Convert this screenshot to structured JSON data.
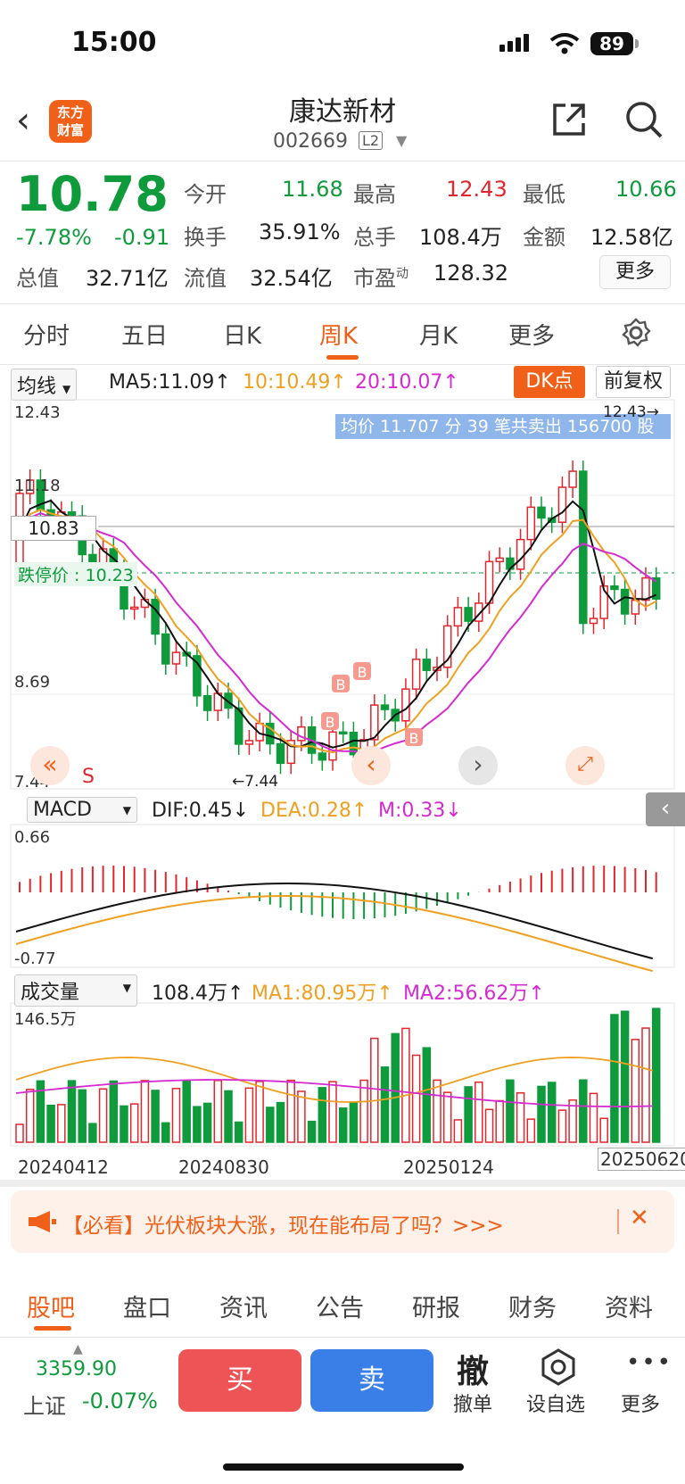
{
  "status": {
    "time": "15:00",
    "battery": "89"
  },
  "header": {
    "logo": [
      "东方",
      "财富"
    ],
    "stock_name": "康达新材",
    "stock_code": "002669",
    "level": "L2"
  },
  "quote": {
    "price": "10.78",
    "change_pct": "-7.78%",
    "change": "-0.91",
    "rows": [
      [
        {
          "label": "今开",
          "value": "11.68",
          "color": "green"
        },
        {
          "label": "最高",
          "value": "12.43",
          "color": "red"
        },
        {
          "label": "最低",
          "value": "10.66",
          "color": "green"
        }
      ],
      [
        {
          "label": "换手",
          "value": "35.91%",
          "color": "black"
        },
        {
          "label": "总手",
          "value": "108.4万",
          "color": "black"
        },
        {
          "label": "金额",
          "value": "12.58亿",
          "color": "black"
        }
      ],
      [
        {
          "label": "总值",
          "value": "32.71亿"
        },
        {
          "label": "流值",
          "value": "32.54亿"
        },
        {
          "label": "市盈",
          "sup": "动",
          "value": "128.32"
        }
      ]
    ],
    "more": "更多"
  },
  "tabs": {
    "items": [
      "分时",
      "五日",
      "日K",
      "周K",
      "月K",
      "更多"
    ],
    "active": 3
  },
  "ma_row": {
    "selector": "均线",
    "ma5": "MA5:11.09↑",
    "ma10": "10:10.49↑",
    "ma20": "20:10.07↑",
    "dk": "DK点",
    "fq": "前复权"
  },
  "kline": {
    "y_top": "12.43",
    "y_2": "11.18",
    "y_3": "8.69",
    "y_bottom": "7.44",
    "current_line": "10.83",
    "limit_label": "跌停价 : 10.23",
    "tooltip": "均价 11.707 分 39 笔共卖出 156700 股",
    "high_mark": "12.43→",
    "low_mark": "←7.44",
    "s_mark": "S"
  },
  "macd_row": {
    "selector": "MACD",
    "dif": "DIF:0.45↓",
    "dea": "DEA:0.28↑",
    "m": "M:0.33↓",
    "y_top": "0.66",
    "y_bottom": "-0.77"
  },
  "vol_row": {
    "selector": "成交量",
    "vol": "108.4万↑",
    "ma1": "MA1:80.95万↑",
    "ma2": "MA2:56.62万↑",
    "y_top": "146.5万"
  },
  "dates": [
    "20240412",
    "20240830",
    "20250124",
    "20250620"
  ],
  "colors": {
    "up": "#e1262d",
    "down": "#0f9b3c",
    "accent": "#f06018",
    "ma10": "#f0a020",
    "ma20": "#d52ad0"
  },
  "ad": {
    "text": "【必看】光伏板块大涨，现在能布局了吗？>>>"
  },
  "sub_tabs": [
    "股吧",
    "盘口",
    "资讯",
    "公告",
    "研报",
    "财务",
    "资料"
  ],
  "bottom": {
    "index_value": "3359.90",
    "index_name": "上证",
    "index_change": "-0.07%",
    "buy": "买",
    "sell": "卖",
    "cancel_big": "撤",
    "cancel": "撤单",
    "watch": "设自选",
    "more": "更多"
  }
}
